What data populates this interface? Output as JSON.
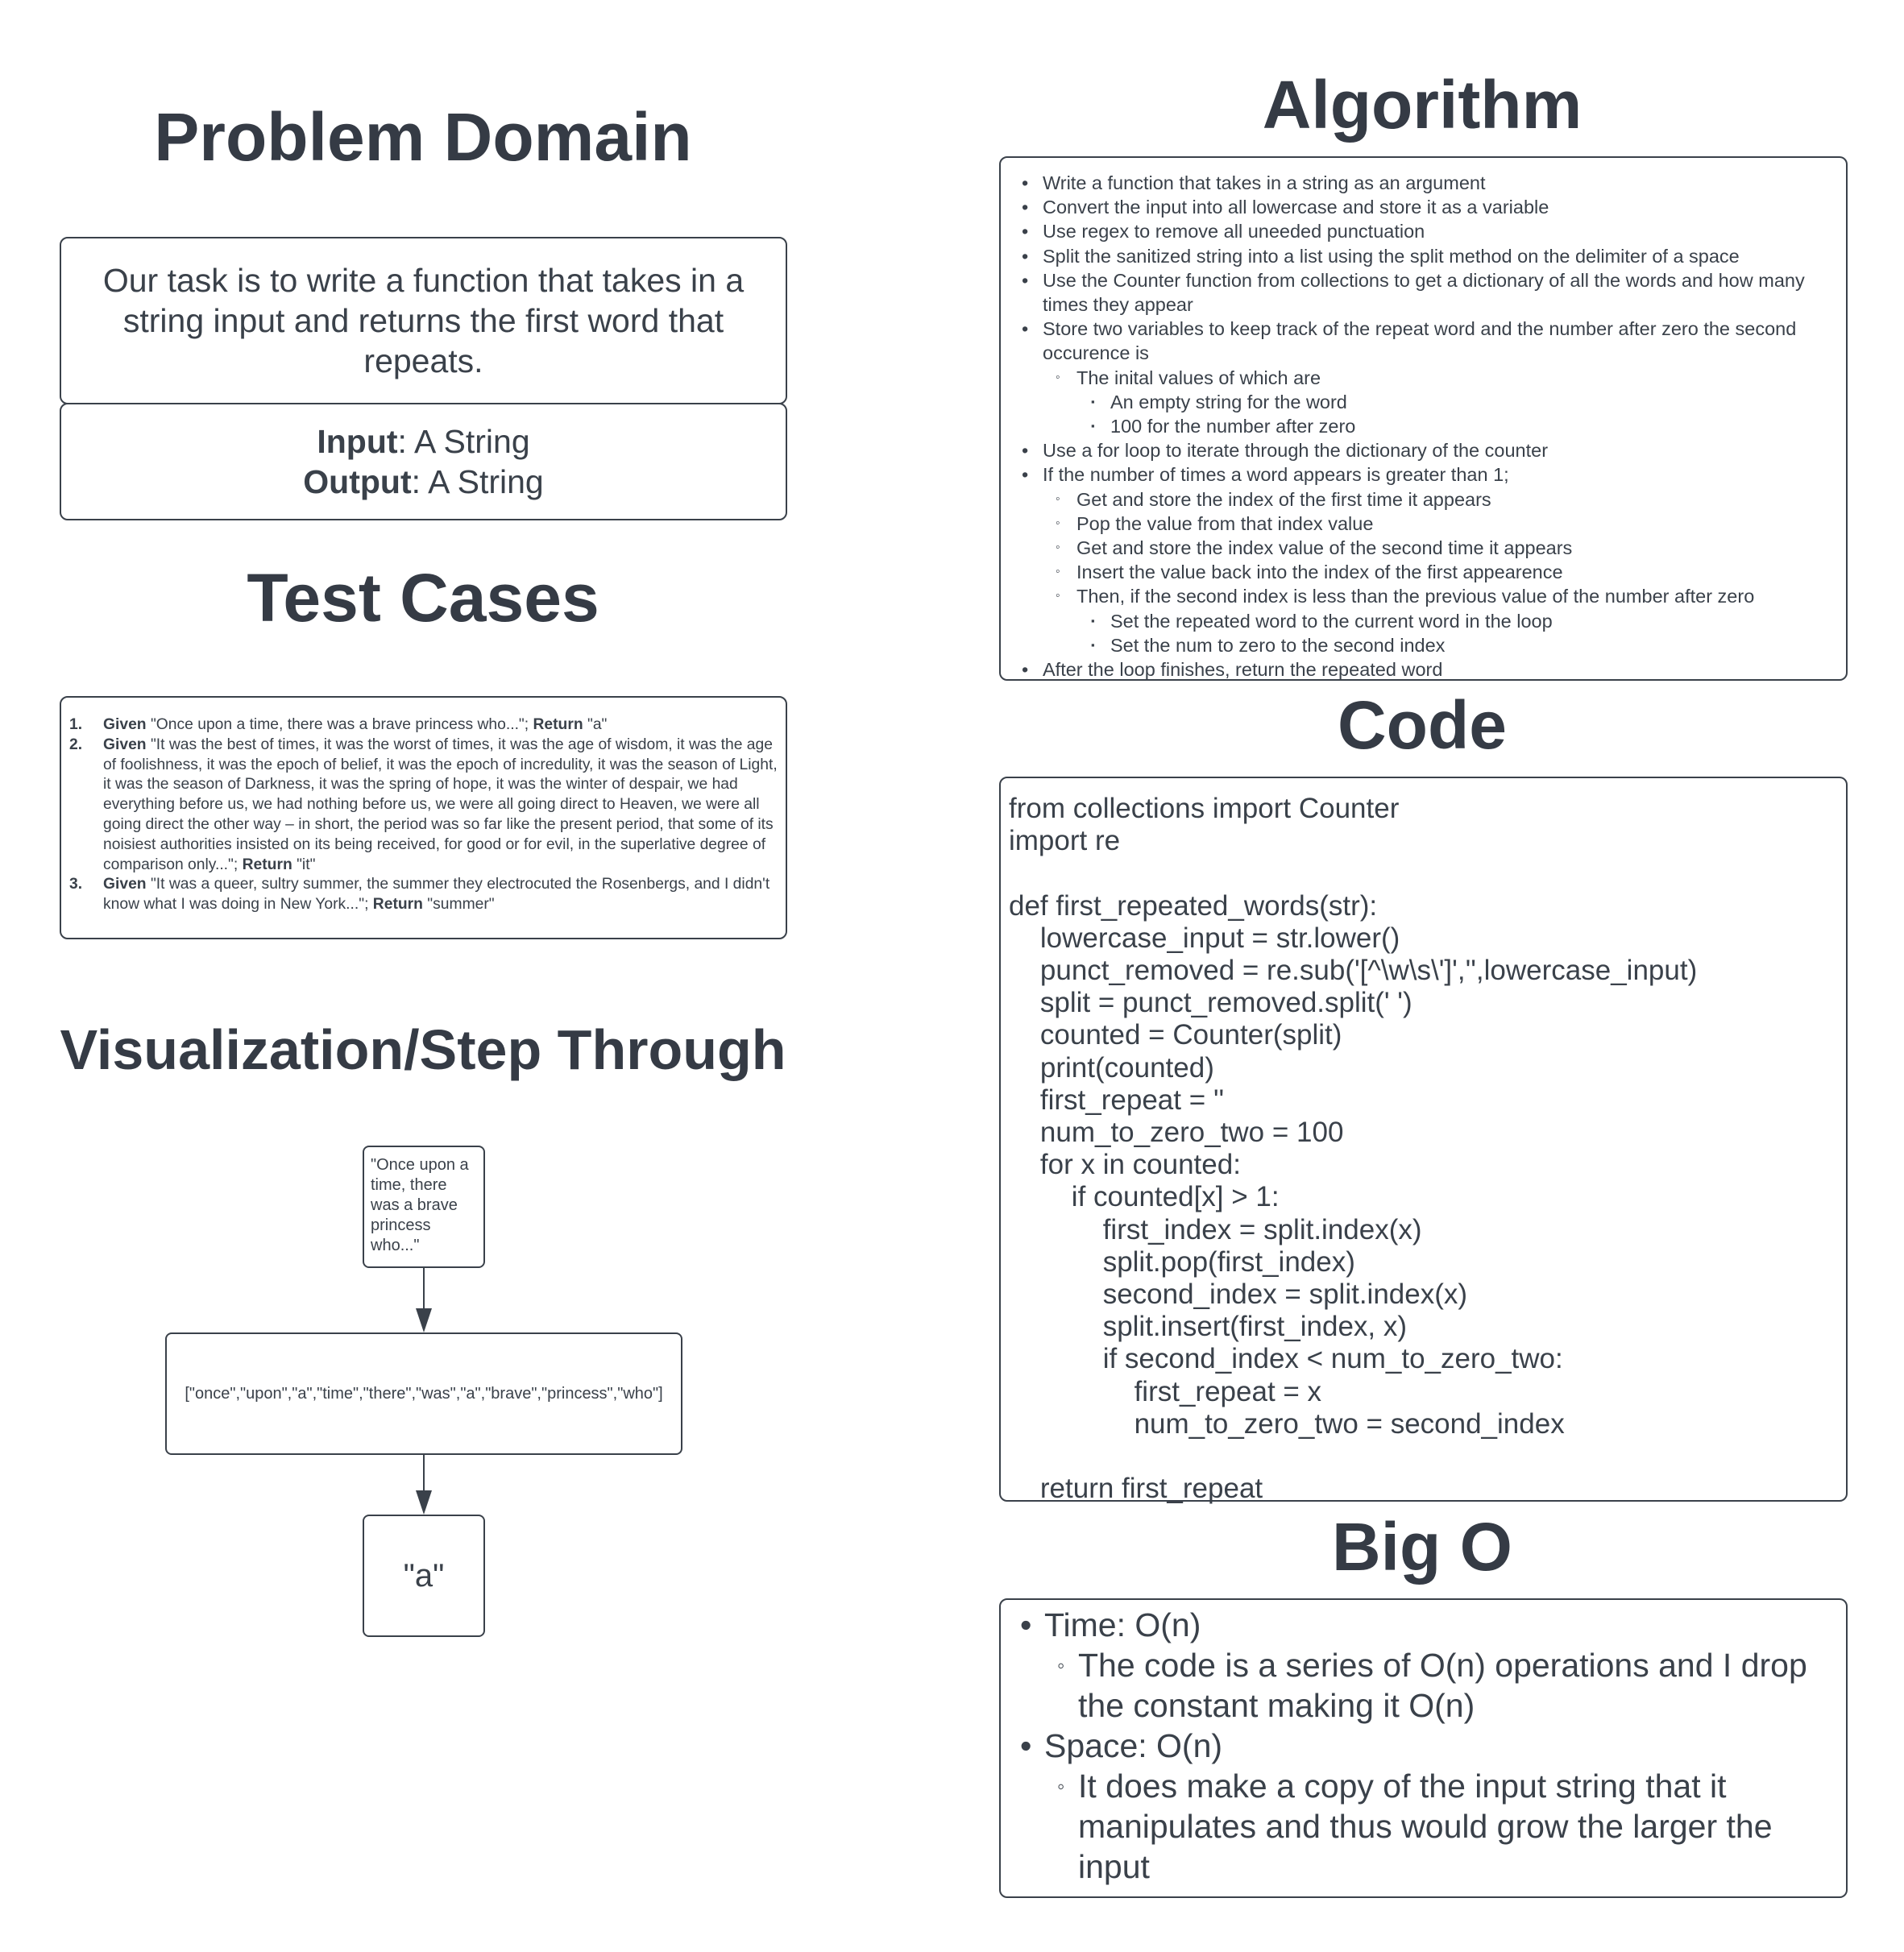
{
  "problem_domain": {
    "title": "Problem Domain",
    "description": "Our task is to write a function that takes in a string input and returns the first word that repeats.",
    "input_label": "Input",
    "input_value": ": A String",
    "output_label": "Output",
    "output_value": ": A String"
  },
  "test_cases": {
    "title": "Test Cases",
    "given_label": "Given",
    "return_label": "Return",
    "items": [
      {
        "num": "1.",
        "given": " \"Once upon a time, there was a brave princess who...\"; ",
        "ret": " \"a\""
      },
      {
        "num": "2.",
        "given": " \"It was the best of times, it was the worst of times, it was the age of wisdom, it was the age of foolishness, it was the epoch of belief, it was the epoch of incredulity, it was the season of Light, it was the season of Darkness, it was the spring of hope, it was the winter of despair, we had everything before us, we had nothing before us, we were all going direct to Heaven, we were all going direct the other way – in short, the period was so far like the present period, that some of its noisiest authorities insisted on its being received, for good or for evil, in the superlative degree of comparison only...\"; ",
        "ret": " \"it\""
      },
      {
        "num": "3.",
        "given": " \"It was a queer, sultry summer, the summer they electrocuted the Rosenbergs, and I didn't know what I was doing in New York...\"; ",
        "ret": " \"summer\""
      }
    ]
  },
  "visualization": {
    "title": "Visualization/Step Through",
    "input": "\"Once upon a time, there was a brave princess who...\"",
    "list": "[\"once\",\"upon\",\"a\",\"time\",\"there\",\"was\",\"a\",\"brave\",\"princess\",\"who\"]",
    "output": "\"a\""
  },
  "algorithm": {
    "title": "Algorithm",
    "items": [
      {
        "level": 0,
        "text": "Write a function that takes in a string as an argument"
      },
      {
        "level": 0,
        "text": "Convert the input into all lowercase and store it as a variable"
      },
      {
        "level": 0,
        "text": "Use regex to remove all uneeded punctuation"
      },
      {
        "level": 0,
        "text": "Split the sanitized string into a list using the split method on the delimiter of a space"
      },
      {
        "level": 0,
        "text": "Use the Counter function from collections to get a dictionary of all the words and how many times they appear"
      },
      {
        "level": 0,
        "text": "Store two variables to keep track of the repeat word and the number after zero the second occurence is"
      },
      {
        "level": 1,
        "text": "The inital values of which are"
      },
      {
        "level": 2,
        "text": "An empty string for the word"
      },
      {
        "level": 2,
        "text": "100 for the number after zero"
      },
      {
        "level": 0,
        "text": "Use a for loop to iterate through the dictionary of the counter"
      },
      {
        "level": 0,
        "text": "If the number of times a word appears is greater than 1;"
      },
      {
        "level": 1,
        "text": "Get and store the index of the first time it appears"
      },
      {
        "level": 1,
        "text": "Pop the value from that index value"
      },
      {
        "level": 1,
        "text": "Get and store the index value of the second time it appears"
      },
      {
        "level": 1,
        "text": "Insert the value back into the index of the first appearence"
      },
      {
        "level": 1,
        "text": "Then, if the second index is less than the previous value of the number after zero"
      },
      {
        "level": 2,
        "text": "Set the repeated word to the current word in the loop"
      },
      {
        "level": 2,
        "text": "Set the num to zero to the second index"
      },
      {
        "level": 0,
        "text": "After the loop finishes, return the repeated word"
      }
    ]
  },
  "code": {
    "title": "Code",
    "source": "from collections import Counter\nimport re\n\ndef first_repeated_words(str):\n    lowercase_input = str.lower()\n    punct_removed = re.sub('[^\\w\\s\\']','',lowercase_input)\n    split = punct_removed.split(' ')\n    counted = Counter(split)\n    print(counted)\n    first_repeat = ''\n    num_to_zero_two = 100\n    for x in counted:\n        if counted[x] > 1:\n            first_index = split.index(x)\n            split.pop(first_index)\n            second_index = split.index(x)\n            split.insert(first_index, x)\n            if second_index < num_to_zero_two:\n                first_repeat = x\n                num_to_zero_two = second_index\n\n    return first_repeat"
  },
  "big_o": {
    "title": "Big O",
    "items": [
      {
        "level": 0,
        "text": "Time: O(n)"
      },
      {
        "level": 1,
        "text": "The code is a series of O(n) operations and I drop the constant making it O(n)"
      },
      {
        "level": 0,
        "text": "Space: O(n)"
      },
      {
        "level": 1,
        "text": "It does make a copy of the input string that it manipulates and thus would grow the larger the input"
      }
    ]
  }
}
